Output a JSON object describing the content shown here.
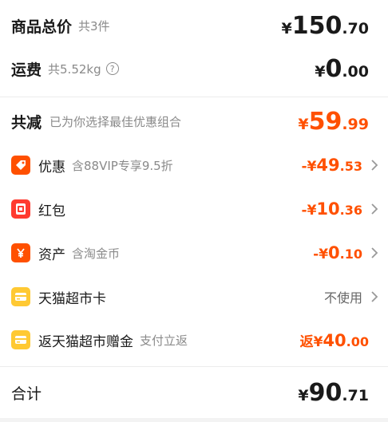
{
  "goods_total": {
    "label": "商品总价",
    "count": "共3件",
    "symbol": "¥",
    "int": "150",
    "dec": ".70"
  },
  "shipping": {
    "label": "运费",
    "weight": "共5.52kg",
    "symbol": "¥",
    "int": "0",
    "dec": ".00"
  },
  "total_reduce": {
    "label": "共减",
    "note": "已为你选择最佳优惠组合",
    "symbol": "¥",
    "int": "59",
    "dec": ".99"
  },
  "items": [
    {
      "label": "优惠",
      "note": "含88VIP专享9.5折",
      "pre": "-¥",
      "int": "49",
      "dec": ".53",
      "icon": "tag-icon",
      "color": "#ff5000"
    },
    {
      "label": "红包",
      "note": "",
      "pre": "-¥",
      "int": "10",
      "dec": ".36",
      "icon": "red-packet-icon",
      "color": "#ff3b30"
    },
    {
      "label": "资产",
      "note": "含淘金币",
      "pre": "-¥",
      "int": "0",
      "dec": ".10",
      "icon": "yuan-coin-icon",
      "color": "#ff5000"
    },
    {
      "label": "天猫超市卡",
      "note": "",
      "status": "不使用",
      "icon": "card-icon",
      "color": "#ffc933"
    },
    {
      "label": "返天猫超市赠金",
      "note": "支付立返",
      "pre": "返¥",
      "int": "40",
      "dec": ".00",
      "icon": "gift-card-icon",
      "color": "#ffc933"
    }
  ],
  "grand_total": {
    "label": "合计",
    "symbol": "¥",
    "int": "90",
    "dec": ".71"
  }
}
